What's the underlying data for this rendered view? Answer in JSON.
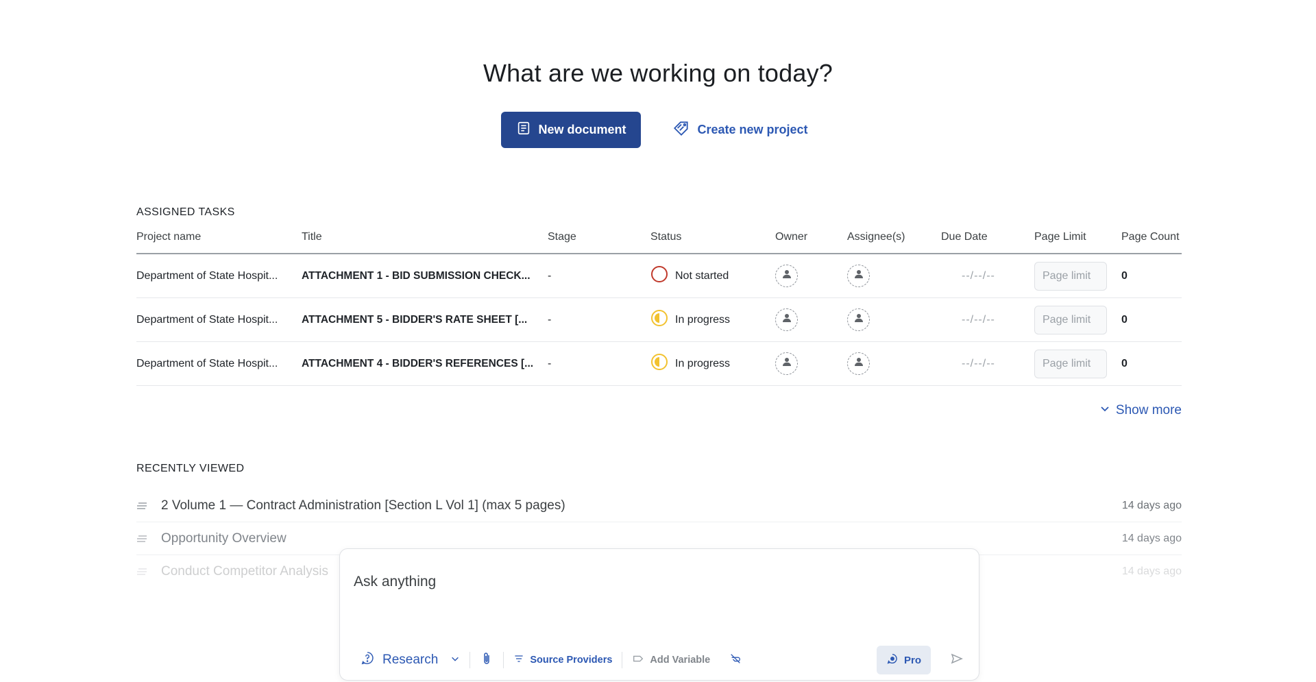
{
  "heading": "What are we working on today?",
  "actions": {
    "new_document": "New document",
    "create_project": "Create new project"
  },
  "assigned_tasks": {
    "label": "ASSIGNED TASKS",
    "columns": [
      "Project name",
      "Title",
      "Stage",
      "Status",
      "Owner",
      "Assignee(s)",
      "Due Date",
      "Page Limit",
      "Page Count"
    ],
    "rows": [
      {
        "project": "Department of State Hospit...",
        "title": "ATTACHMENT 1 - BID SUBMISSION CHECK...",
        "stage": "-",
        "status": "Not started",
        "due": "--/--/--",
        "page_limit_placeholder": "Page limit",
        "page_count": "0"
      },
      {
        "project": "Department of State Hospit...",
        "title": "ATTACHMENT 5 - BIDDER'S RATE SHEET [...",
        "stage": "-",
        "status": "In progress",
        "due": "--/--/--",
        "page_limit_placeholder": "Page limit",
        "page_count": "0"
      },
      {
        "project": "Department of State Hospit...",
        "title": "ATTACHMENT 4 - BIDDER'S REFERENCES [...",
        "stage": "-",
        "status": "In progress",
        "due": "--/--/--",
        "page_limit_placeholder": "Page limit",
        "page_count": "0"
      }
    ],
    "show_more": "Show more"
  },
  "recently_viewed": {
    "label": "RECENTLY VIEWED",
    "items": [
      {
        "title": "2 Volume 1 — Contract Administration [Section L Vol 1] (max 5 pages)",
        "time": "14 days ago"
      },
      {
        "title": "Opportunity Overview",
        "time": "14 days ago"
      },
      {
        "title": "Conduct Competitor Analysis",
        "time": "14 days ago"
      }
    ]
  },
  "chat": {
    "placeholder": "Ask anything",
    "mode": "Research",
    "source_providers": "Source Providers",
    "add_variable": "Add Variable",
    "pro": "Pro"
  },
  "colors": {
    "primary": "#25468f",
    "link": "#2c58b3",
    "not_started": "#c0392b",
    "in_progress": "#f2c230"
  }
}
